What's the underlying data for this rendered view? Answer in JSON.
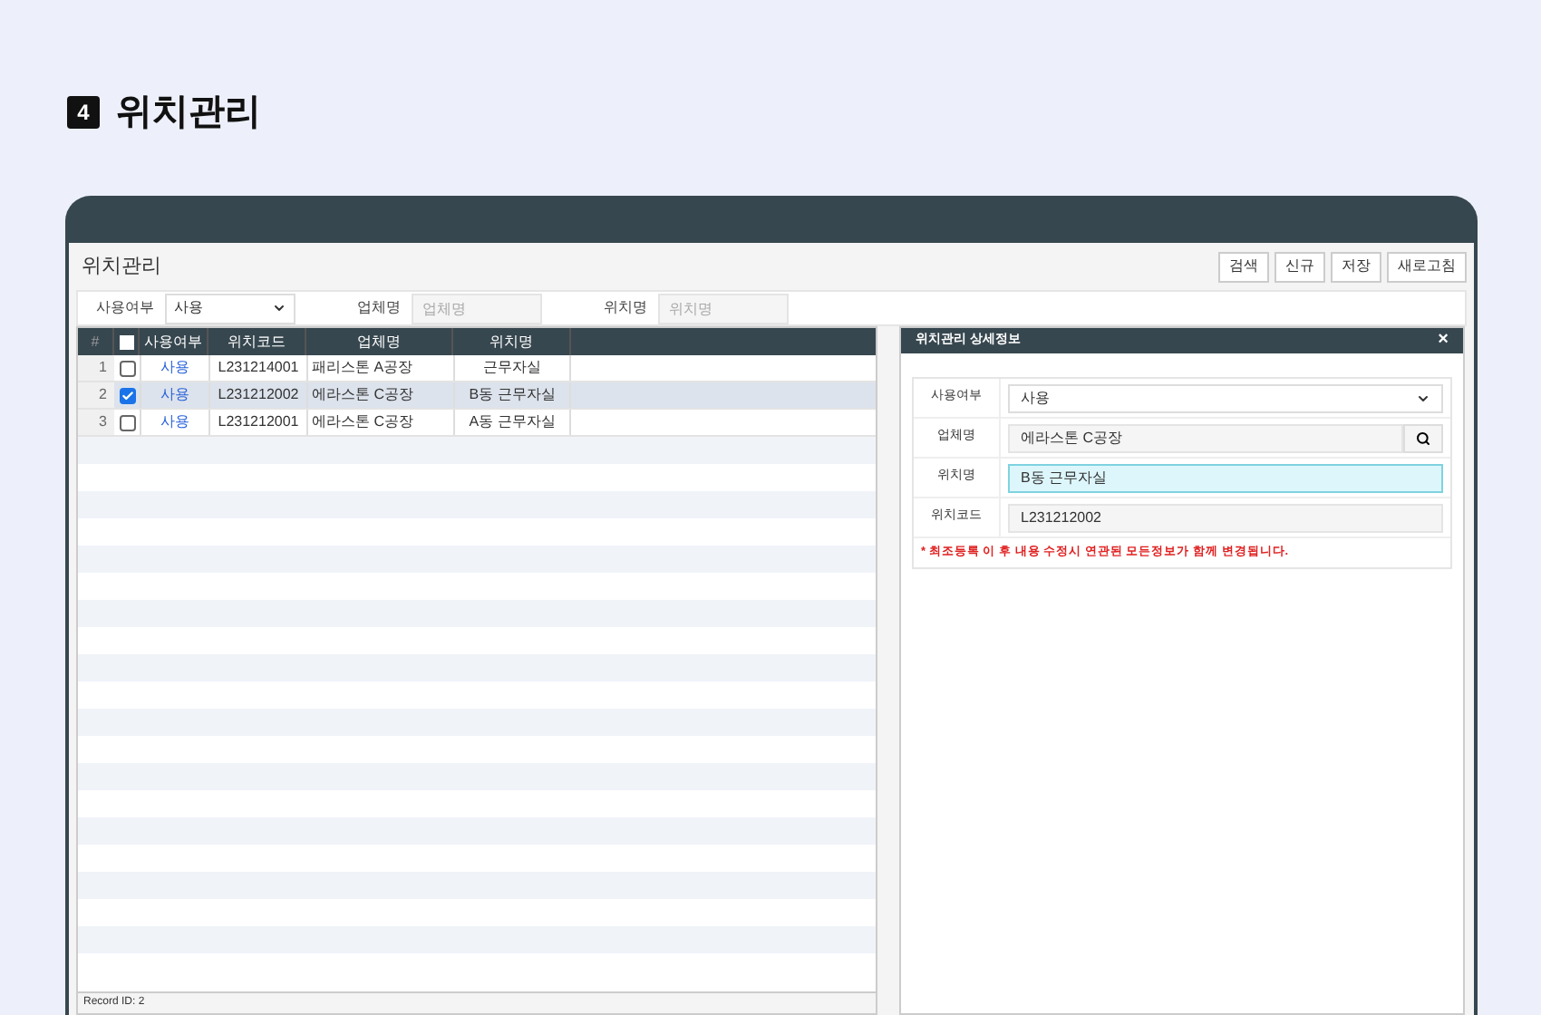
{
  "section": {
    "number": "4",
    "title": "위치관리"
  },
  "window": {
    "title": "위치관리"
  },
  "buttons": [
    "검색",
    "신규",
    "저장",
    "새로고침"
  ],
  "filters": [
    {
      "kind": "select",
      "label": "사용여부",
      "value": "사용"
    },
    {
      "kind": "text",
      "label": "업체명",
      "placeholder": "업체명"
    },
    {
      "kind": "text",
      "label": "위치명",
      "placeholder": "위치명"
    }
  ],
  "table": {
    "all_checked": false,
    "columns": [
      "#",
      "사용여부",
      "위치코드",
      "업체명",
      "위치명"
    ],
    "rows": [
      {
        "index": "1",
        "selected": false,
        "checked": false,
        "use": "사용",
        "code": "L231214001",
        "company": "패리스톤 A공장",
        "location": "근무자실"
      },
      {
        "index": "2",
        "selected": true,
        "checked": true,
        "use": "사용",
        "code": "L231212002",
        "company": "에라스톤 C공장",
        "location": "B동 근무자실"
      },
      {
        "index": "3",
        "selected": false,
        "checked": false,
        "use": "사용",
        "code": "L231212001",
        "company": "에라스톤 C공장",
        "location": "A동 근무자실"
      }
    ],
    "footer": "Record ID: 2"
  },
  "detail": {
    "title": "위치관리 상세정보",
    "close": "×",
    "fields": [
      {
        "kind": "select",
        "label": "사용여부",
        "value": "사용",
        "focused": false
      },
      {
        "kind": "search",
        "label": "업체명",
        "value": "에라스톤 C공장",
        "focused": false
      },
      {
        "kind": "text",
        "label": "위치명",
        "value": "B동 근무자실",
        "focused": true
      },
      {
        "kind": "text",
        "label": "위치코드",
        "value": "L231212002",
        "focused": false
      }
    ],
    "notice": "* 최조등록 이 후 내용 수정시 연관된 모든정보가 함께 변경됩니다."
  }
}
